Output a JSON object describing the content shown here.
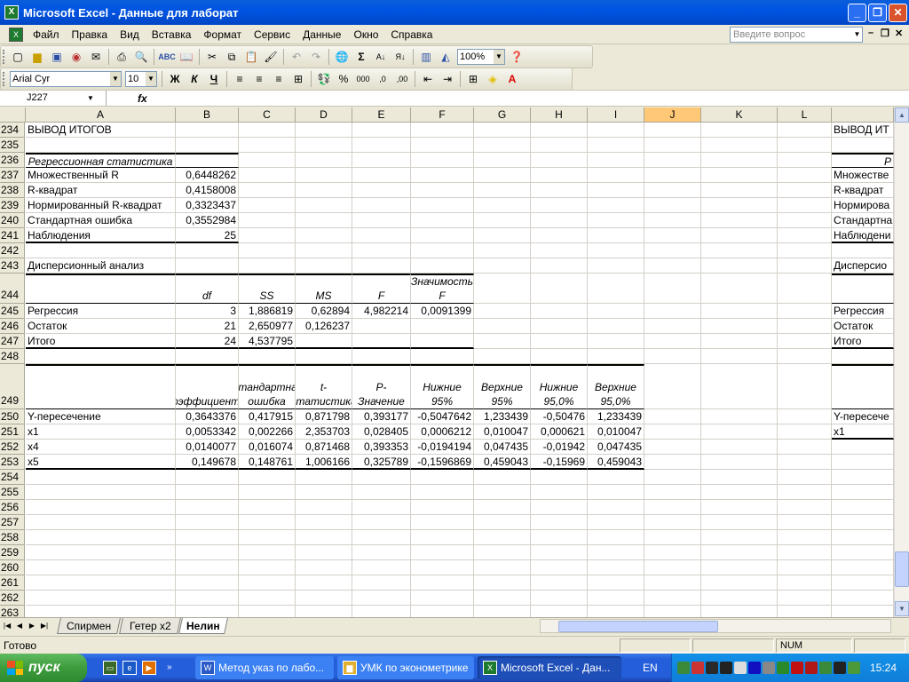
{
  "window": {
    "title": "Microsoft Excel - Данные для лаборат",
    "app_icon": "excel-icon"
  },
  "menu": {
    "items": [
      "Файл",
      "Правка",
      "Вид",
      "Вставка",
      "Формат",
      "Сервис",
      "Данные",
      "Окно",
      "Справка"
    ],
    "ask_placeholder": "Введите вопрос"
  },
  "toolbar": {
    "zoom": "100%",
    "font": "Arial Cyr",
    "size": "10",
    "bold": "Ж",
    "italic": "К",
    "underline": "Ч"
  },
  "formula_bar": {
    "name_box": "J227",
    "fx": "fx",
    "content": ""
  },
  "columns": [
    "A",
    "B",
    "C",
    "D",
    "E",
    "F",
    "G",
    "H",
    "I",
    "J",
    "K",
    "L"
  ],
  "selected_column": "J",
  "rows": [
    {
      "n": "234",
      "cells": {
        "A": "ВЫВОД ИТОГОВ"
      },
      "right": "ВЫВОД ИТ"
    },
    {
      "n": "235",
      "cells": {}
    },
    {
      "n": "236",
      "cells": {
        "A": "Регрессионная статистика"
      },
      "right": "Р"
    },
    {
      "n": "237",
      "cells": {
        "A": "Множественный R",
        "B": "0,6448262"
      },
      "right": "Множестве"
    },
    {
      "n": "238",
      "cells": {
        "A": "R-квадрат",
        "B": "0,4158008"
      },
      "right": "R-квадрат"
    },
    {
      "n": "239",
      "cells": {
        "A": "Нормированный R-квадрат",
        "B": "0,3323437"
      },
      "right": "Нормирова"
    },
    {
      "n": "240",
      "cells": {
        "A": "Стандартная ошибка",
        "B": "0,3552984"
      },
      "right": "Стандартна"
    },
    {
      "n": "241",
      "cells": {
        "A": "Наблюдения",
        "B": "25"
      },
      "right": "Наблюдени"
    },
    {
      "n": "242",
      "cells": {}
    },
    {
      "n": "243",
      "cells": {
        "A": "Дисперсионный анализ"
      },
      "right": "Дисперсио"
    },
    {
      "n": "244",
      "cells": {
        "B": "df",
        "C": "SS",
        "D": "MS",
        "E": "F",
        "F": "Значимость F"
      }
    },
    {
      "n": "245",
      "cells": {
        "A": "Регрессия",
        "B": "3",
        "C": "1,886819",
        "D": "0,62894",
        "E": "4,982214",
        "F": "0,0091399"
      },
      "right": "Регрессия"
    },
    {
      "n": "246",
      "cells": {
        "A": "Остаток",
        "B": "21",
        "C": "2,650977",
        "D": "0,126237"
      },
      "right": "Остаток"
    },
    {
      "n": "247",
      "cells": {
        "A": "Итого",
        "B": "24",
        "C": "4,537795"
      },
      "right": "Итого"
    },
    {
      "n": "248",
      "cells": {}
    },
    {
      "n": "249",
      "cells": {
        "B": "Коэффициенты",
        "C": "Стандартная ошибка",
        "D": "t-статистика",
        "E": "P-Значение",
        "F": "Нижние 95%",
        "G": "Верхние 95%",
        "H": "Нижние 95,0%",
        "I": "Верхние 95,0%"
      }
    },
    {
      "n": "250",
      "cells": {
        "A": "Y-пересечение",
        "B": "0,3643376",
        "C": "0,417915",
        "D": "0,871798",
        "E": "0,393177",
        "F": "-0,5047642",
        "G": "1,233439",
        "H": "-0,50476",
        "I": "1,233439"
      },
      "right": "Y-пересече"
    },
    {
      "n": "251",
      "cells": {
        "A": "x1",
        "B": "0,0053342",
        "C": "0,002266",
        "D": "2,353703",
        "E": "0,028405",
        "F": "0,0006212",
        "G": "0,010047",
        "H": "0,000621",
        "I": "0,010047"
      },
      "right": "x1"
    },
    {
      "n": "252",
      "cells": {
        "A": "x4",
        "B": "0,0140077",
        "C": "0,016074",
        "D": "0,871468",
        "E": "0,393353",
        "F": "-0,0194194",
        "G": "0,047435",
        "H": "-0,01942",
        "I": "0,047435"
      }
    },
    {
      "n": "253",
      "cells": {
        "A": "x5",
        "B": "0,149678",
        "C": "0,148761",
        "D": "1,006166",
        "E": "0,325789",
        "F": "-0,1596869",
        "G": "0,459043",
        "H": "-0,15969",
        "I": "0,459043"
      }
    },
    {
      "n": "254",
      "cells": {}
    },
    {
      "n": "255",
      "cells": {}
    },
    {
      "n": "256",
      "cells": {}
    },
    {
      "n": "257",
      "cells": {}
    },
    {
      "n": "258",
      "cells": {}
    },
    {
      "n": "259",
      "cells": {}
    },
    {
      "n": "260",
      "cells": {}
    },
    {
      "n": "261",
      "cells": {}
    },
    {
      "n": "262",
      "cells": {}
    },
    {
      "n": "263",
      "cells": {}
    }
  ],
  "sheets": [
    {
      "name": "Спирмен",
      "active": false
    },
    {
      "name": "Гетер х2",
      "active": false
    },
    {
      "name": "Нелин",
      "active": true
    }
  ],
  "status": {
    "left": "Готово",
    "num": "NUM"
  },
  "taskbar": {
    "start": "пуск",
    "items": [
      "Метод указ по лабо...",
      "УМК по эконометрике",
      "Microsoft Excel - Дан..."
    ],
    "lang": "EN",
    "clock": "15:24"
  }
}
